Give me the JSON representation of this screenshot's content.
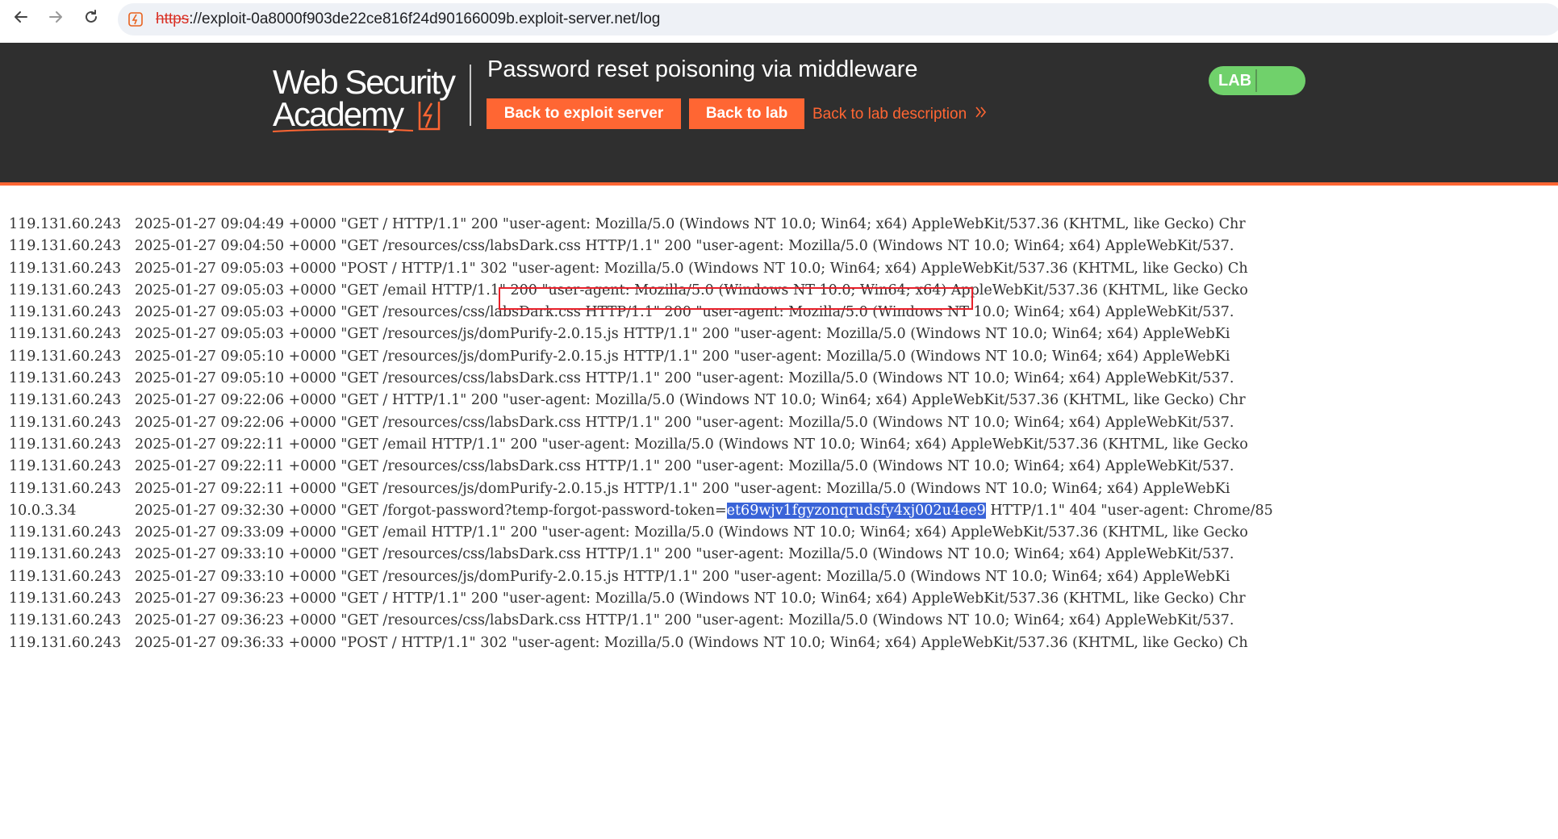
{
  "browser": {
    "url_protocol": "https",
    "url_rest": "://exploit-0a8000f903de22ce816f24d90166009b.exploit-server.net/log",
    "back_icon": "arrow-left-icon",
    "forward_icon": "arrow-right-icon",
    "reload_icon": "reload-icon",
    "site_icon": "site-warning-icon"
  },
  "header": {
    "logo_line1": "Web Security",
    "logo_line2": "Academy",
    "title": "Password reset poisoning via middleware",
    "back_to_exploit_server": "Back to exploit server",
    "back_to_lab": "Back to lab",
    "back_to_lab_description": "Back to lab description",
    "lab_badge": "LAB",
    "colors": {
      "header_bg": "#2f2f2f",
      "accent": "#ff6633",
      "badge": "#70d16b"
    }
  },
  "log": {
    "rows": [
      {
        "ip": "119.131.60.243",
        "text": "2025-01-27 09:04:49 +0000 \"GET / HTTP/1.1\" 200 \"user-agent: Mozilla/5.0 (Windows NT 10.0; Win64; x64) AppleWebKit/537.36 (KHTML, like Gecko) Chr"
      },
      {
        "ip": "119.131.60.243",
        "text": "2025-01-27 09:04:50 +0000 \"GET /resources/css/labsDark.css HTTP/1.1\" 200 \"user-agent: Mozilla/5.0 (Windows NT 10.0; Win64; x64) AppleWebKit/537."
      },
      {
        "ip": "119.131.60.243",
        "text": "2025-01-27 09:05:03 +0000 \"POST / HTTP/1.1\" 302 \"user-agent: Mozilla/5.0 (Windows NT 10.0; Win64; x64) AppleWebKit/537.36 (KHTML, like Gecko) Ch"
      },
      {
        "ip": "119.131.60.243",
        "text": "2025-01-27 09:05:03 +0000 \"GET /email HTTP/1.1\" 200 \"user-agent: Mozilla/5.0 (Windows NT 10.0; Win64; x64) AppleWebKit/537.36 (KHTML, like Gecko"
      },
      {
        "ip": "119.131.60.243",
        "text": "2025-01-27 09:05:03 +0000 \"GET /resources/css/labsDark.css HTTP/1.1\" 200 \"user-agent: Mozilla/5.0 (Windows NT 10.0; Win64; x64) AppleWebKit/537."
      },
      {
        "ip": "119.131.60.243",
        "text": "2025-01-27 09:05:03 +0000 \"GET /resources/js/domPurify-2.0.15.js HTTP/1.1\" 200 \"user-agent: Mozilla/5.0 (Windows NT 10.0; Win64; x64) AppleWebKi"
      },
      {
        "ip": "119.131.60.243",
        "text": "2025-01-27 09:05:10 +0000 \"GET /resources/js/domPurify-2.0.15.js HTTP/1.1\" 200 \"user-agent: Mozilla/5.0 (Windows NT 10.0; Win64; x64) AppleWebKi"
      },
      {
        "ip": "119.131.60.243",
        "text": "2025-01-27 09:05:10 +0000 \"GET /resources/css/labsDark.css HTTP/1.1\" 200 \"user-agent: Mozilla/5.0 (Windows NT 10.0; Win64; x64) AppleWebKit/537."
      },
      {
        "ip": "119.131.60.243",
        "text": "2025-01-27 09:22:06 +0000 \"GET / HTTP/1.1\" 200 \"user-agent: Mozilla/5.0 (Windows NT 10.0; Win64; x64) AppleWebKit/537.36 (KHTML, like Gecko) Chr"
      },
      {
        "ip": "119.131.60.243",
        "text": "2025-01-27 09:22:06 +0000 \"GET /resources/css/labsDark.css HTTP/1.1\" 200 \"user-agent: Mozilla/5.0 (Windows NT 10.0; Win64; x64) AppleWebKit/537."
      },
      {
        "ip": "119.131.60.243",
        "text": "2025-01-27 09:22:11 +0000 \"GET /email HTTP/1.1\" 200 \"user-agent: Mozilla/5.0 (Windows NT 10.0; Win64; x64) AppleWebKit/537.36 (KHTML, like Gecko"
      },
      {
        "ip": "119.131.60.243",
        "text": "2025-01-27 09:22:11 +0000 \"GET /resources/css/labsDark.css HTTP/1.1\" 200 \"user-agent: Mozilla/5.0 (Windows NT 10.0; Win64; x64) AppleWebKit/537."
      },
      {
        "ip": "119.131.60.243",
        "text": "2025-01-27 09:22:11 +0000 \"GET /resources/js/domPurify-2.0.15.js HTTP/1.1\" 200 \"user-agent: Mozilla/5.0 (Windows NT 10.0; Win64; x64) AppleWebKi"
      },
      {
        "ip": "10.0.3.34",
        "text_before": "2025-01-27 09:32:30 +0000 \"GET /forgot-password?temp-forgot-password-token=",
        "text_selected": "et69wjv1fgyzonqrudsfy4xj002u4ee9",
        "text_after": " HTTP/1.1\" 404 \"user-agent: Chrome/85"
      },
      {
        "ip": "119.131.60.243",
        "text": "2025-01-27 09:33:09 +0000 \"GET /email HTTP/1.1\" 200 \"user-agent: Mozilla/5.0 (Windows NT 10.0; Win64; x64) AppleWebKit/537.36 (KHTML, like Gecko"
      },
      {
        "ip": "119.131.60.243",
        "text": "2025-01-27 09:33:10 +0000 \"GET /resources/css/labsDark.css HTTP/1.1\" 200 \"user-agent: Mozilla/5.0 (Windows NT 10.0; Win64; x64) AppleWebKit/537."
      },
      {
        "ip": "119.131.60.243",
        "text": "2025-01-27 09:33:10 +0000 \"GET /resources/js/domPurify-2.0.15.js HTTP/1.1\" 200 \"user-agent: Mozilla/5.0 (Windows NT 10.0; Win64; x64) AppleWebKi"
      },
      {
        "ip": "119.131.60.243",
        "text": "2025-01-27 09:36:23 +0000 \"GET / HTTP/1.1\" 200 \"user-agent: Mozilla/5.0 (Windows NT 10.0; Win64; x64) AppleWebKit/537.36 (KHTML, like Gecko) Chr"
      },
      {
        "ip": "119.131.60.243",
        "text": "2025-01-27 09:36:23 +0000 \"GET /resources/css/labsDark.css HTTP/1.1\" 200 \"user-agent: Mozilla/5.0 (Windows NT 10.0; Win64; x64) AppleWebKit/537."
      },
      {
        "ip": "119.131.60.243",
        "text": "2025-01-27 09:36:33 +0000 \"POST / HTTP/1.1\" 302 \"user-agent: Mozilla/5.0 (Windows NT 10.0; Win64; x64) AppleWebKit/537.36 (KHTML, like Gecko) Ch"
      }
    ]
  }
}
